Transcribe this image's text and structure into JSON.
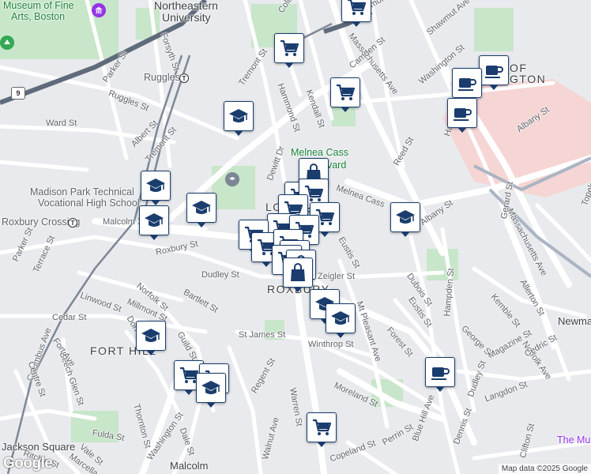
{
  "map": {
    "attribution": "Map data ©2025 Google",
    "logo": "Google"
  },
  "labels": {
    "museum_line1": "Museum of Fine",
    "museum_line2": "Arts, Boston",
    "northeastern_line1": "Northeastern",
    "northeastern_line2": "University",
    "ruggles": "Ruggles",
    "roxbury_crossing": "Roxbury Crossing",
    "madison_line1": "Madison Park Technical",
    "madison_line2": "Vocational High School",
    "melnea_cass_line1": "Melnea Cass",
    "melnea_cass_line2": "Boulevard",
    "jackson_square": "Jackson Square",
    "the_mu": "The Mu",
    "newman": "Newman",
    "hood_roxbury": "ROXBURY",
    "hood_fort_hill": "FORT HILL",
    "hood_lower_roxbury": "LO",
    "hood_south_end_1": "OF",
    "hood_south_end_2": "GTON",
    "malcolm": "Malcolm",
    "route_9": "9"
  },
  "streets": {
    "columbus_ave_top": "Columbus Ave",
    "tremont_st_top": "Tremont St",
    "massachusetts_ave": "Massachusetts Ave",
    "shawmut_ave": "Shawmut Ave",
    "washington_st_top": "Washington St",
    "camden_st": "Camden St",
    "hammond_st": "Hammond St",
    "kendall_st": "Kendall St",
    "parker_st_top": "Parker St",
    "forsyth_st": "Forsyth St",
    "ruggles_st": "Ruggles St",
    "ward_st": "Ward St",
    "albert_st": "Albert St",
    "tremont_st_mid": "Tremont St",
    "dewitt_dr": "Dewitt Dr",
    "reed_st": "Reed St",
    "harrison_ave": "Harrison Ave",
    "albany_st_top": "Albany St",
    "albany_st_mid": "Albany St",
    "melnea_cass_blvd": "Melnea Cass",
    "malcolm_x_blvd": "Malcolm X Blvd",
    "roxbury_st": "Roxbury St",
    "parker_st_left": "Parker St",
    "terrace_st": "Terrace St",
    "eustis_st_top": "Eustis St",
    "dudley_st_top": "Dudley St",
    "zeigler_st": "Zeigler St",
    "norfolk_st": "Norfolk St",
    "bartlett_st": "Bartlett St",
    "linwood_st": "Linwood St",
    "millmont_st": "Millmont St",
    "cedar_st": "Cedar St",
    "columbus_ave_left": "Columbus Ave",
    "guild_st": "Guild St",
    "st_james_st": "St James St",
    "winthrop_st": "Winthrop St",
    "mt_pleasant_ave": "Mt Pleasant Ave",
    "dubois_st": "Dubois St",
    "eustis_st_bottom": "Eustis St",
    "forest_st": "Forest St",
    "hampden_st": "Hampden St",
    "george_st": "George St",
    "magazine_st": "Magazine St",
    "kemble_st": "Kemble St",
    "allerton_st": "Allerton St",
    "gerard_st": "Gerard St",
    "massachusetts_ave_right": "Massachusetts Ave",
    "norfolk_ave": "Norfolk Ave",
    "cedric_st": "Cedric St",
    "topeka_st": "Topek",
    "moreland_st": "Moreland St",
    "regent_st": "Regent St",
    "blue_hill_ave": "Blue Hill Ave",
    "dudley_st_bottom": "Dudley St",
    "langdon_st": "Langdon St",
    "dennis_st": "Dennis St",
    "clifton_st": "Clifton St",
    "perrin_st": "Perrin St",
    "copeland_st": "Copeland St",
    "warren_st": "Warren St",
    "walnut_ave": "Walnut Ave",
    "dale_st": "Dale St",
    "washington_st_bottom": "Washington St",
    "thornton_st": "Thornton St",
    "fulda_st": "Fulda St",
    "vale_st": "Vale St",
    "marcella_st": "Marcella",
    "ritchie_st": "Ritchie St",
    "beech_glen_st": "Beech Glen St",
    "centre_st": "Centre St",
    "fort_ave": "Fort Ave",
    "dorr_st": "Dorr St"
  },
  "markers": [
    {
      "kind": "grocery-cart",
      "icon": "shopping-cart-icon"
    },
    {
      "kind": "cafe",
      "icon": "coffee-cup-icon"
    },
    {
      "kind": "school",
      "icon": "graduation-cap-icon"
    },
    {
      "kind": "shop",
      "icon": "shopping-bag-icon"
    }
  ],
  "colors": {
    "marker_navy": "#1a3d6e",
    "park_green": "#c8e6c9",
    "road_white": "#ffffff",
    "highway_dark": "#5f6a7a",
    "pink_area": "#f6d5d5"
  }
}
